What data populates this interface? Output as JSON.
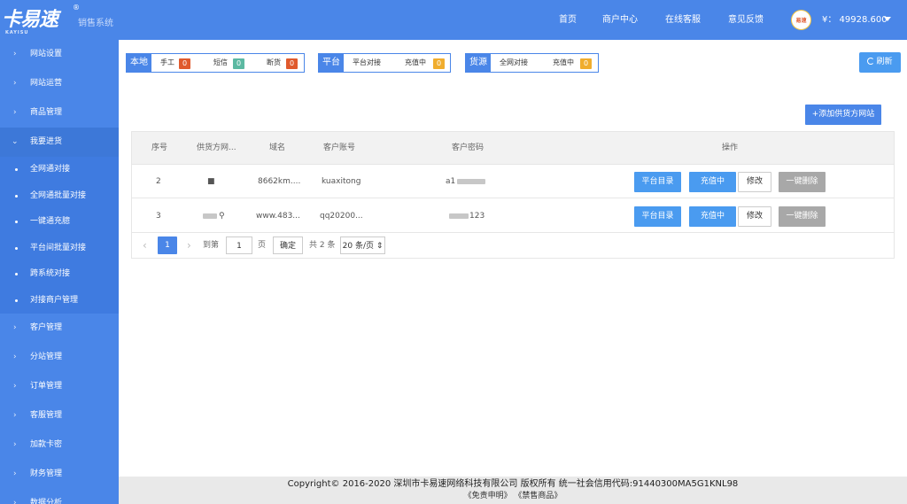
{
  "brand": {
    "logo": "卡易速",
    "logo_mark": "®",
    "logo_sub": "KAYISU",
    "system_name": "销售系统"
  },
  "nav": {
    "home": "首页",
    "merchant_center": "商户中心",
    "online_service": "在线客服",
    "feedback": "意见反馈"
  },
  "user": {
    "avatar_text": "易速",
    "balance": "¥： 49928.600"
  },
  "sidebar": {
    "items": [
      {
        "label": "网站设置",
        "expanded": false
      },
      {
        "label": "网站运营",
        "expanded": false
      },
      {
        "label": "商品管理",
        "expanded": false
      },
      {
        "label": "我要进货",
        "expanded": true
      },
      {
        "label": "客户管理",
        "expanded": false
      },
      {
        "label": "分站管理",
        "expanded": false
      },
      {
        "label": "订单管理",
        "expanded": false
      },
      {
        "label": "客服管理",
        "expanded": false
      },
      {
        "label": "加款卡密",
        "expanded": false
      },
      {
        "label": "财务管理",
        "expanded": false
      },
      {
        "label": "数据分析",
        "expanded": false
      }
    ],
    "subitems": [
      "全网通对接",
      "全网通批量对接",
      "一键通充臆",
      "平台间批量对接",
      "跨系统对接",
      "对接商户管理"
    ]
  },
  "stats": {
    "local": {
      "tag": "本地",
      "items": [
        {
          "label": "手工",
          "count": "0",
          "color": "#e05a2d"
        },
        {
          "label": "短信",
          "count": "0",
          "color": "#5cb9a2"
        },
        {
          "label": "断货",
          "count": "0",
          "color": "#e05a2d"
        }
      ]
    },
    "platform": {
      "tag": "平台",
      "items": [
        {
          "label": "平台对接",
          "count": ""
        },
        {
          "label": "充值中",
          "count": "0",
          "color": "#f0ad2e"
        }
      ]
    },
    "source": {
      "tag": "货源",
      "items": [
        {
          "label": "全网对接",
          "count": ""
        },
        {
          "label": "充值中",
          "count": "0",
          "color": "#f0ad2e"
        }
      ]
    }
  },
  "toolbar": {
    "refresh": "刷新",
    "add_supplier": "+添加供货方网站"
  },
  "table": {
    "headers": [
      "序号",
      "供货方网...",
      "域名",
      "客户账号",
      "客户密码",
      "操作"
    ],
    "rows": [
      {
        "index": "2",
        "supplier": "■",
        "domain": "8662km....",
        "account": "kuaxitong",
        "password": "a1",
        "password_tail": ""
      },
      {
        "index": "3",
        "supplier": "",
        "domain": "www.483...",
        "account": "qq20200...",
        "password": "",
        "password_tail": "123"
      }
    ],
    "actions": {
      "catalog": "平台目录",
      "recharging": "充值中",
      "edit": "修改",
      "delete": "一键删除"
    }
  },
  "pager": {
    "prev": "‹",
    "current": "1",
    "next": "›",
    "goto_label": "到第",
    "goto_value": "1",
    "page_label": "页",
    "confirm": "确定",
    "total": "共 2 条",
    "page_size": "20 条/页 ⇕"
  },
  "footer": {
    "copyright": "Copyright© 2016-2020 深圳市卡易速网络科技有限公司 版权所有 统一社会信用代码:91440300MA5G1KNL98",
    "links": "《免责申明》 《禁售商品》"
  },
  "colors": {
    "primary": "#4a86e8",
    "button_blue": "#4a9bf0",
    "danger": "#e05a2d",
    "success": "#5cb9a2",
    "warning": "#f0ad2e",
    "disabled": "#a8a8a8"
  }
}
